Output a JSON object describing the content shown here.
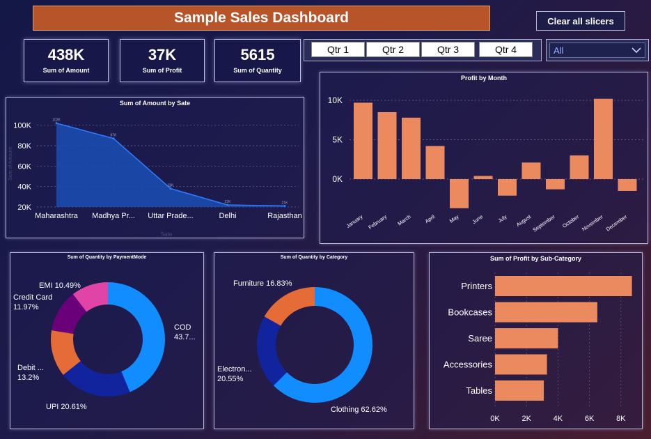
{
  "header": {
    "title": "Sample Sales Dashboard",
    "clear_label": "Clear all slicers"
  },
  "kpis": [
    {
      "value": "438K",
      "label": "Sum of Amount"
    },
    {
      "value": "37K",
      "label": "Sum of Profit"
    },
    {
      "value": "5615",
      "label": "Sum of Quantity"
    }
  ],
  "quarters": [
    "Qtr 1",
    "Qtr 2",
    "Qtr 3",
    "Qtr 4"
  ],
  "state_filter": {
    "value": "All",
    "icon": "chevron-down-icon"
  },
  "colors": {
    "title_bar": "#b7542a",
    "bar": "#eb8a5e",
    "area": "#1a4fb5",
    "cod": "#118dff",
    "upi": "#12239e",
    "debit": "#e66c37",
    "credit": "#6b007b",
    "emi": "#e044a7"
  },
  "chart_data": [
    {
      "type": "area",
      "title": "Sum of Amount by Sate",
      "xlabel": "Sate",
      "ylabel": "Sum of Amount",
      "categories": [
        "Maharashtra",
        "Madhya Pr...",
        "Uttar Prade...",
        "Delhi",
        "Rajasthan"
      ],
      "values": [
        102000,
        87000,
        38000,
        22000,
        21000
      ],
      "yticks": [
        "20K",
        "40K",
        "60K",
        "80K",
        "100K"
      ],
      "data_labels": [
        "102K",
        "87K",
        "38K",
        "22K",
        "21K"
      ],
      "ylim": [
        20000,
        110000
      ]
    },
    {
      "type": "bar",
      "title": "Profit by Month",
      "categories": [
        "January",
        "February",
        "March",
        "April",
        "May",
        "June",
        "July",
        "August",
        "September",
        "October",
        "November",
        "December"
      ],
      "values": [
        9700,
        8500,
        7800,
        4200,
        -3700,
        400,
        -2100,
        2100,
        -1300,
        3000,
        10200,
        -1500
      ],
      "yticks": [
        "10K",
        "5K",
        "0K"
      ],
      "ylim": [
        -4000,
        11000
      ]
    },
    {
      "type": "pie",
      "title": "Sum of Quantity by PaymentMode",
      "slices": [
        {
          "name": "COD",
          "value": 43.7,
          "label": "COD\n43.7..."
        },
        {
          "name": "UPI",
          "value": 20.61,
          "label": "UPI 20.61%"
        },
        {
          "name": "Debit Card",
          "value": 13.2,
          "label": "Debit ...\n13.2%"
        },
        {
          "name": "Credit Card",
          "value": 11.97,
          "label": "Credit Card\n11.97%"
        },
        {
          "name": "EMI",
          "value": 10.49,
          "label": "EMI 10.49%"
        }
      ]
    },
    {
      "type": "pie",
      "title": "Sum of Quantity by Category",
      "slices": [
        {
          "name": "Clothing",
          "value": 62.62,
          "label": "Clothing 62.62%"
        },
        {
          "name": "Electronics",
          "value": 20.55,
          "label": "Electron...\n20.55%"
        },
        {
          "name": "Furniture",
          "value": 16.83,
          "label": "Furniture 16.83%"
        }
      ]
    },
    {
      "type": "bar",
      "orientation": "horizontal",
      "title": "Sum of Profit by Sub-Category",
      "categories": [
        "Printers",
        "Bookcases",
        "Saree",
        "Accessories",
        "Tables"
      ],
      "values": [
        8700,
        6500,
        4000,
        3300,
        3100
      ],
      "xticks": [
        "0K",
        "2K",
        "4K",
        "6K",
        "8K"
      ],
      "xlim": [
        0,
        9000
      ]
    }
  ]
}
